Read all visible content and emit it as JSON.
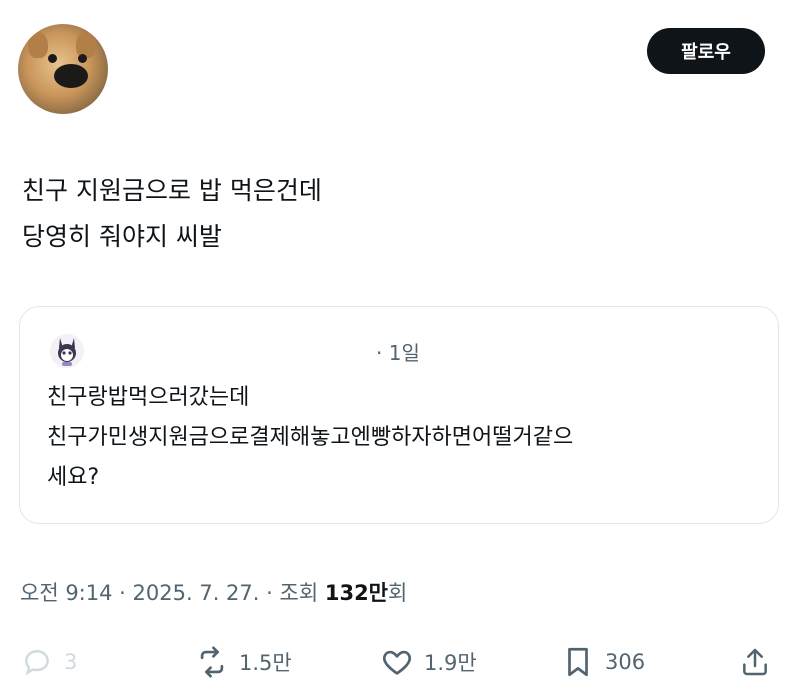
{
  "header": {
    "follow_label": "팔로우"
  },
  "tweet": {
    "lines": [
      "친구 지원금으로 밥 먹은건데",
      "당영히 줘야지 씨발"
    ]
  },
  "quoted": {
    "time": "· 1일",
    "lines": [
      "친구랑밥먹으러갔는데",
      "친구가민생지원금으로결제해놓고엔빵하자하면어떨거같으",
      "세요?"
    ]
  },
  "meta": {
    "time": "오전 9:14",
    "date": "2025. 7. 27.",
    "views_label": "조회",
    "views_count": "132만",
    "views_suffix": "회",
    "sep": "·"
  },
  "actions": {
    "reply_count": "3",
    "retweet_count": "1.5만",
    "like_count": "1.9만",
    "bookmark_count": "306"
  },
  "colors": {
    "text": "#0f1419",
    "muted": "#536471",
    "border": "#e3e6e9",
    "button_bg": "#0f1419"
  },
  "icons": [
    "reply-icon",
    "retweet-icon",
    "like-icon",
    "bookmark-icon",
    "share-icon"
  ]
}
